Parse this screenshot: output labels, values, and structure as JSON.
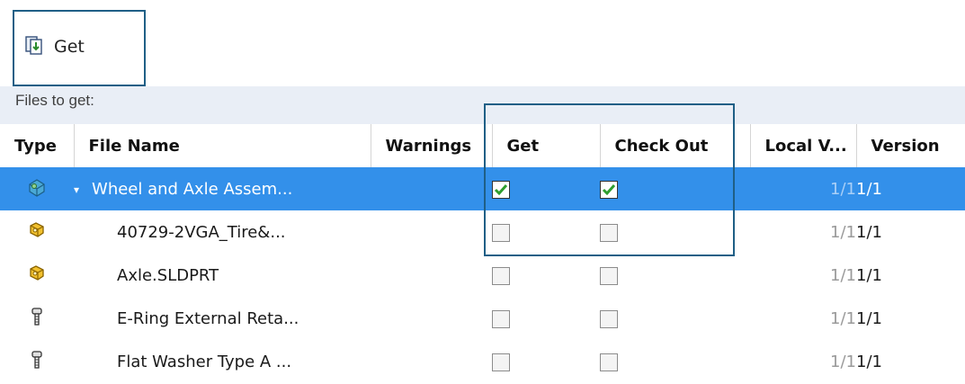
{
  "toolbar": {
    "get_label": "Get",
    "get_icon": "get-files-icon"
  },
  "files_to_get_label": "Files to get:",
  "columns": [
    "Type",
    "File Name",
    "Warnings",
    "Get",
    "Check Out",
    "Local V...",
    "Version"
  ],
  "rows": [
    {
      "type_icon": "assembly-icon",
      "name": "Wheel and Axle Assem...",
      "expandable": true,
      "warnings": "",
      "get": true,
      "check_out": true,
      "local_version": "1/1",
      "version": "1/1",
      "selected": true
    },
    {
      "type_icon": "part-icon",
      "name": "40729-2VGA_Tire&...",
      "expandable": false,
      "warnings": "",
      "get": false,
      "check_out": false,
      "local_version": "1/1",
      "version": "1/1",
      "selected": false
    },
    {
      "type_icon": "part-icon",
      "name": "Axle.SLDPRT",
      "expandable": false,
      "warnings": "",
      "get": false,
      "check_out": false,
      "local_version": "1/1",
      "version": "1/1",
      "selected": false
    },
    {
      "type_icon": "toolbox-part-icon",
      "name": "E-Ring External Reta...",
      "expandable": false,
      "warnings": "",
      "get": false,
      "check_out": false,
      "local_version": "1/1",
      "version": "1/1",
      "selected": false
    },
    {
      "type_icon": "toolbox-part-icon",
      "name": "Flat Washer Type A ...",
      "expandable": false,
      "warnings": "",
      "get": false,
      "check_out": false,
      "local_version": "1/1",
      "version": "1/1",
      "selected": false
    }
  ],
  "colors": {
    "selection": "#3390ea",
    "highlight_border": "#1f5f86",
    "header_bar": "#e9eef6",
    "check_green": "#2e9e2e"
  }
}
